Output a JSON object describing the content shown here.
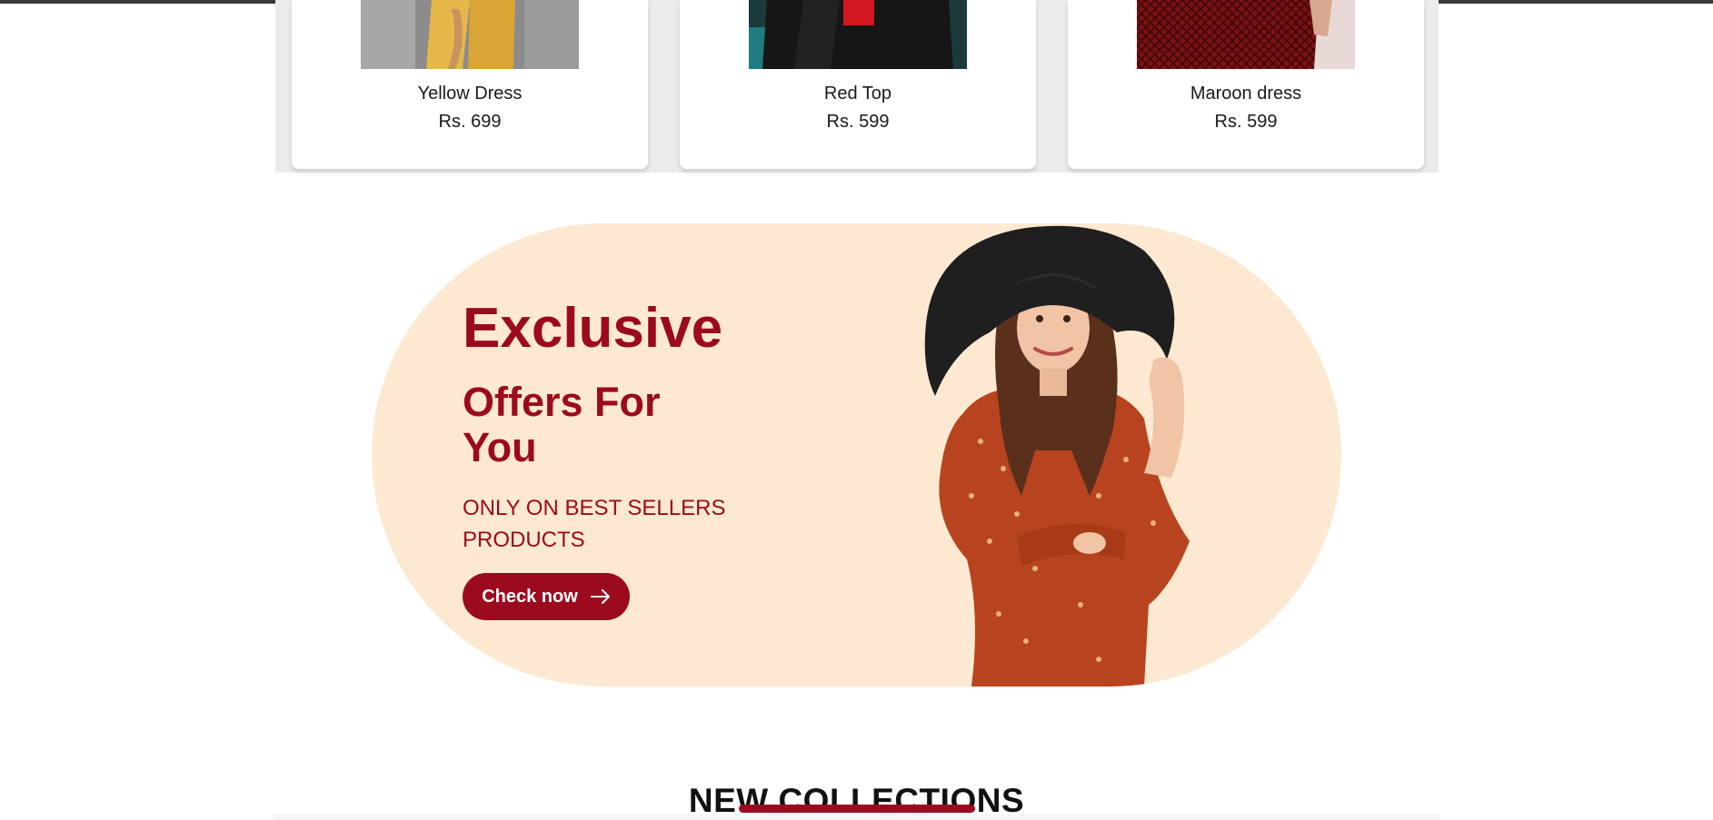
{
  "products": [
    {
      "name": "Yellow Dress",
      "price": "Rs. 699"
    },
    {
      "name": "Red Top",
      "price": "Rs. 599"
    },
    {
      "name": "Maroon dress",
      "price": "Rs. 599"
    }
  ],
  "offer": {
    "title": "Exclusive",
    "subtitle": "Offers For You",
    "note": "ONLY ON BEST SELLERS PRODUCTS",
    "button_label": "Check now",
    "accent_color": "#9c0a1e",
    "background_color": "#fde9d2"
  },
  "collections": {
    "title": "NEW COLLECTIONS"
  },
  "icons": {
    "button_icon": "arrow-right-icon"
  }
}
